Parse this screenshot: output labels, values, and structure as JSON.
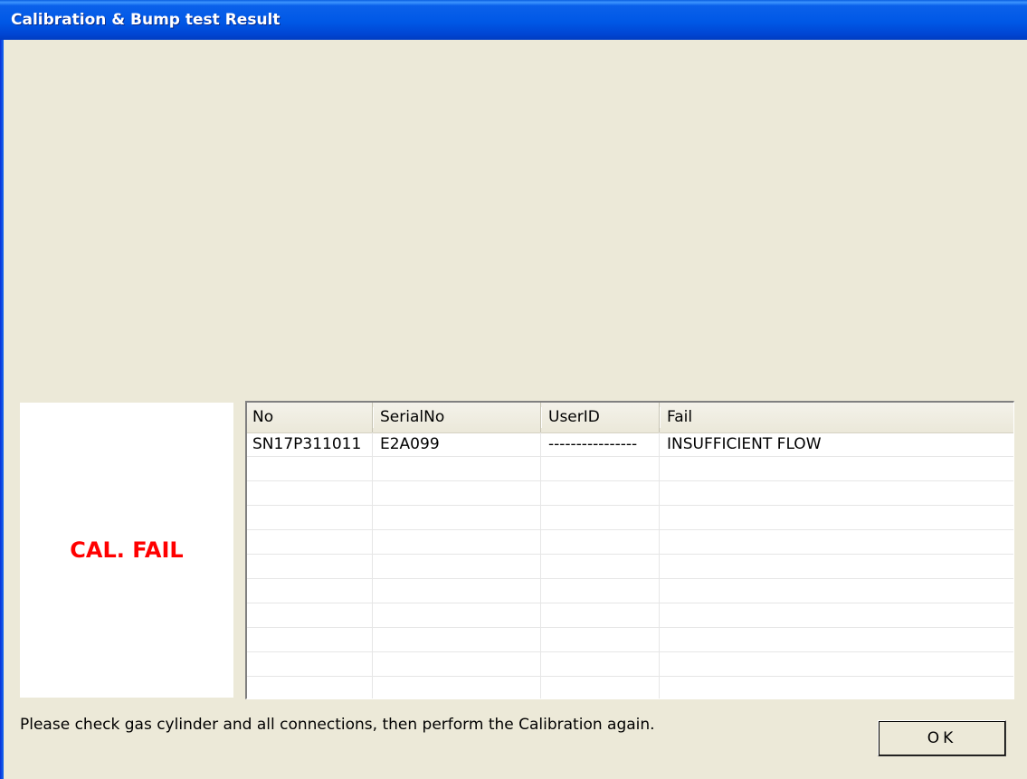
{
  "window": {
    "title": "Calibration & Bump test Result"
  },
  "status": {
    "text": "CAL. FAIL",
    "color": "#ff0000"
  },
  "table": {
    "columns": [
      "No",
      "SerialNo",
      "UserID",
      "Fail"
    ],
    "rows": [
      [
        "SN17P311011",
        "E2A099",
        "----------------",
        "INSUFFICIENT FLOW"
      ],
      [
        "",
        "",
        "",
        ""
      ],
      [
        "",
        "",
        "",
        ""
      ],
      [
        "",
        "",
        "",
        ""
      ],
      [
        "",
        "",
        "",
        ""
      ],
      [
        "",
        "",
        "",
        ""
      ],
      [
        "",
        "",
        "",
        ""
      ],
      [
        "",
        "",
        "",
        ""
      ],
      [
        "",
        "",
        "",
        ""
      ],
      [
        "",
        "",
        "",
        ""
      ],
      [
        "",
        "",
        "",
        ""
      ]
    ]
  },
  "message": "Please check gas cylinder and all connections, then perform the Calibration again.",
  "buttons": {
    "ok_label": "OK"
  }
}
